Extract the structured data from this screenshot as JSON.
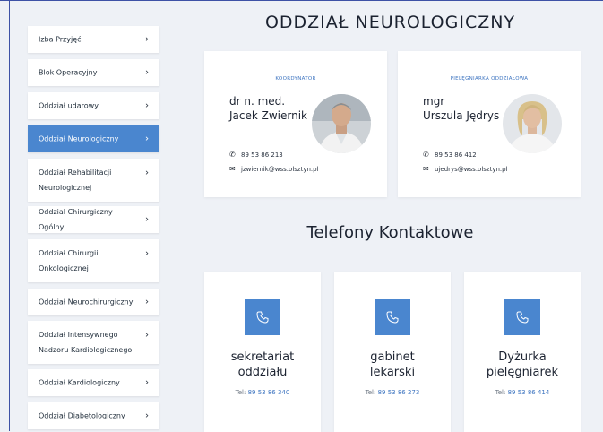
{
  "sidebar": {
    "items": [
      {
        "label": "Izba Przyjęć",
        "active": false
      },
      {
        "label": "Blok Operacyjny",
        "active": false
      },
      {
        "label": "Oddział udarowy",
        "active": false
      },
      {
        "label": "Oddział Neurologiczny",
        "active": true
      },
      {
        "label": "Oddział Rehabilitacji Neurologicznej",
        "active": false
      },
      {
        "label": "Oddział Chirurgiczny Ogólny",
        "active": false
      },
      {
        "label": "Oddział Chirurgii Onkologicznej",
        "active": false
      },
      {
        "label": "Oddział Neurochirurgiczny",
        "active": false
      },
      {
        "label": "Oddział Intensywnego Nadzoru Kardiologicznego",
        "active": false
      },
      {
        "label": "Oddział Kardiologiczny",
        "active": false
      },
      {
        "label": "Oddział Diabetologiczny",
        "active": false
      }
    ],
    "chevron": "›"
  },
  "main": {
    "title": "ODDZIAŁ NEUROLOGICZNY",
    "subtitle": "Telefony Kontaktowe",
    "contacts": [
      {
        "role": "KOORDYNATOR",
        "name_line1": "dr n. med.",
        "name_line2": "Jacek Zwiernik",
        "phone": "89 53 86 213",
        "email": "jzwiernik@wss.olsztyn.pl"
      },
      {
        "role": "PIELĘGNIARKA ODDZIAŁOWA",
        "name_line1": "mgr",
        "name_line2": "Urszula Jędrys",
        "phone": "89 53 86 412",
        "email": "ujedrys@wss.olsztyn.pl"
      }
    ],
    "phones": [
      {
        "line1": "sekretariat",
        "line2": "oddziału",
        "tel_prefix": "Tel:",
        "tel": "89 53 86 340"
      },
      {
        "line1": "gabinet",
        "line2": "lekarski",
        "tel_prefix": "Tel:",
        "tel": "89 53 86 273"
      },
      {
        "line1": "Dyżurka",
        "line2": "pielęgniarek",
        "tel_prefix": "Tel:",
        "tel": "89 53 86 414"
      }
    ]
  },
  "colors": {
    "accent": "#4a86cf",
    "link": "#3d74c0",
    "background": "#eef1f6"
  }
}
